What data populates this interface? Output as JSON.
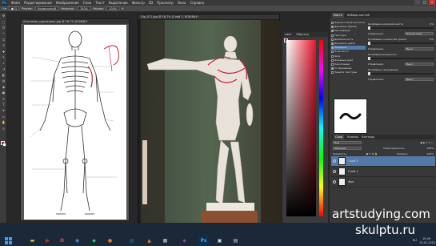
{
  "app": {
    "logo": "Ps",
    "menu": [
      "Файл",
      "Редактирование",
      "Изображение",
      "Слои",
      "Текст",
      "Выделение",
      "Фильтр",
      "3D",
      "Просмотр",
      "Окно",
      "Справка"
    ]
  },
  "options_bar": {
    "mode_label": "Режим:",
    "mode_value": "Нормальный",
    "opacity_label": "Непрозр.:",
    "opacity_value": "100%",
    "pressure_label": "Нажим:",
    "pressure_value": "100%"
  },
  "documents": [
    {
      "tab": "Анатомия_художника.jpg @ 16,7% (RGB/8)*"
    },
    {
      "tab": "Gip_071.jpg @ 16,7% (Слой 2, RGB/8#)*"
    }
  ],
  "color_panel": {
    "tabs": [
      "Цвет",
      "Образцы"
    ]
  },
  "brush_panel": {
    "tabs": [
      "Кисть",
      "Наборы кистей"
    ],
    "list": [
      {
        "label": "Форма отпечатка кисти",
        "checked": false,
        "selected": false
      },
      {
        "label": "Динамика формы",
        "checked": true,
        "selected": false
      },
      {
        "label": "Рассеивание",
        "checked": true,
        "selected": false
      },
      {
        "label": "Текстура",
        "checked": false,
        "selected": false
      },
      {
        "label": "Двойная кисть",
        "checked": false,
        "selected": false
      },
      {
        "label": "Динамика цвета",
        "checked": true,
        "selected": false
      },
      {
        "label": "Передача",
        "checked": true,
        "selected": true
      },
      {
        "label": "Поза кисти",
        "checked": false,
        "selected": false
      },
      {
        "label": "Шум",
        "checked": false,
        "selected": false
      },
      {
        "label": "Влажные края",
        "checked": false,
        "selected": false
      },
      {
        "label": "Накопление",
        "checked": false,
        "selected": false
      },
      {
        "label": "Сглаживание",
        "checked": true,
        "selected": false
      },
      {
        "label": "Защита текстуры",
        "checked": false,
        "selected": false
      }
    ],
    "right": {
      "row1_label": "Колебание непрозрачности",
      "row1_value": "0%",
      "control1_label": "Управление:",
      "control1_value": "Нажим пера",
      "row2_label": "Колебание количества краски",
      "row2_value": "0%",
      "control2_label": "Управление:",
      "control2_value": "Выкл.",
      "row3_label": "Колебание влажности",
      "control3_label": "Управление:",
      "control3_value": "Выкл.",
      "row4_label": "Колебание смешивания",
      "control4_label": "Управление:",
      "control4_value": "Выкл."
    }
  },
  "layers_panel": {
    "tabs": [
      "Слои",
      "Каналы",
      "Контуры"
    ],
    "kind_label": "Вид",
    "blend_value": "Обычные",
    "opacity_label": "Непрозрачность:",
    "opacity_value": "100%",
    "lock_label": "Закрепить:",
    "fill_label": "Заливка:",
    "fill_value": "100%",
    "layers": [
      {
        "name": "Слой 2",
        "selected": true
      },
      {
        "name": "Слой 1",
        "selected": false
      },
      {
        "name": "Фон",
        "selected": false
      }
    ]
  },
  "taskbar": {
    "clock_time": "15:49",
    "clock_date": "13.01.2015",
    "lang": "RU"
  },
  "watermark": {
    "line1": "artstudying.com",
    "line2": "skulptu.ru"
  },
  "colors": {
    "foreground": "#c41f3b",
    "background": "#ffffff",
    "accent": "#5379aa"
  }
}
